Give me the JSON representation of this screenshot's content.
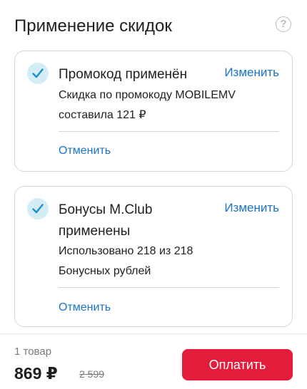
{
  "header": {
    "title": "Применение скидок",
    "help_icon": "?"
  },
  "promo": {
    "title": "Промокод применён",
    "change_label": "Изменить",
    "description_line1": "Скидка по промокоду MOBILEMV",
    "description_line2": "составила 121 ₽",
    "cancel_label": "Отменить"
  },
  "bonus": {
    "title_line1": "Бонусы M.Club",
    "title_line2": "применены",
    "change_label": "Изменить",
    "description_line1": "Использовано 218 из 218",
    "description_line2": "Бонусных рублей",
    "cancel_label": "Отменить"
  },
  "footer": {
    "items_count": "1 товар",
    "total_price": "869 ₽",
    "old_price": "2 599",
    "pay_label": "Оплатить"
  },
  "colors": {
    "accent_link": "#1a73c8",
    "pay_button": "#e21c3a",
    "check_bg": "#d4ecf6",
    "check_mark": "#1a8fc8"
  },
  "icons": {
    "help": "question-circle-icon",
    "check": "check-icon"
  }
}
